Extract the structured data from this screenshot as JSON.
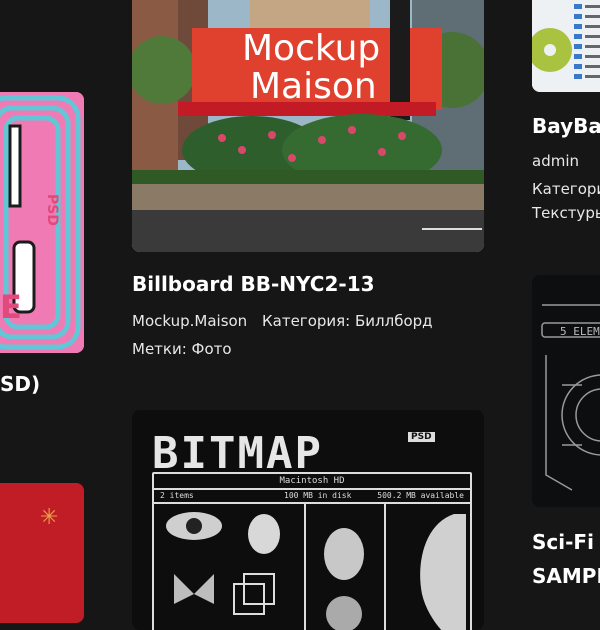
{
  "colors": {
    "background": "#161616",
    "text": "#ffffff",
    "meta_text": "#e8e8e8",
    "mockup_billboard_red": "#e0412f",
    "left_thumb_pink": "#f07ab3",
    "left_thumb_cyan": "#63c6d6",
    "left_bottom_red": "#c9202a"
  },
  "left_column": {
    "card_top": {
      "title_fragment": "SD)",
      "image": {
        "badge": "PSD",
        "letter_fragment": "E"
      }
    },
    "card_bottom": {
      "image": {
        "icon": "asterisk-icon"
      }
    }
  },
  "center_column": {
    "card_billboard": {
      "image": {
        "billboard_line1": "Mockup",
        "billboard_line2": "Maison"
      },
      "title": "Billboard BB-NYC2-13",
      "author": "Mockup.Maison",
      "category": "Категория: Биллборд",
      "tags": "Метки: Фото"
    },
    "card_bitmap": {
      "image": {
        "headline": "BITMAP",
        "badge": "PSD",
        "window_title": "Macintosh HD",
        "items": "2 items",
        "disk": "100 MB in disk",
        "available": "500.2 MB available"
      }
    }
  },
  "right_column": {
    "card_top": {
      "title_fragment": "BayBay",
      "author": "admin",
      "category_fragment": "Категори",
      "tags_fragment": "Текстуры"
    },
    "card_bottom": {
      "image": {
        "label": "5 ELEM"
      },
      "title_line1": "Sci-Fi I",
      "title_line2": "SAMPL"
    }
  }
}
